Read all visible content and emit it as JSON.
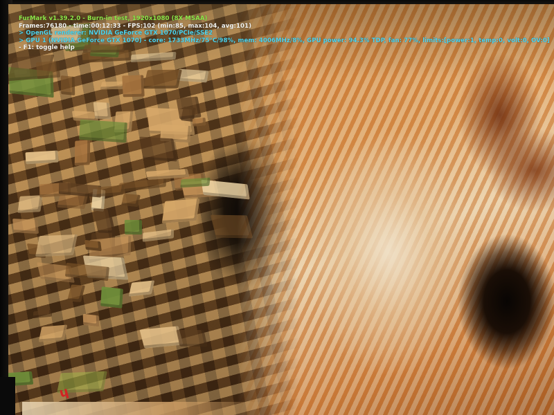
{
  "app": "FurMark",
  "osd": {
    "title": "FurMark v1.39.2.0 - Burn-in test, 1920x1080 (8X MSAA)",
    "frames": "Frames:76180 - time:00:12:33 - FPS:102 (min:85, max:104, avg:101)",
    "renderer": "> OpenGL renderer: NVIDIA GeForce GTX 1070/PCIe/SSE2",
    "gpu": "> GPU 1 (NVIDIA GeForce GTX 1070) - core: 1733MHz/75°C/98%, mem: 4006MHz/8%, GPU power: 94.3% TDP, fan: 77%, limits:[power:1, temp:0, volt:0, OV:0]",
    "help": "- F1: toggle help"
  },
  "colors": {
    "title": "#8fe84a",
    "info": "#f4f4f0",
    "accent": "#4fd6f0",
    "tunnel_tint": "#9a6a38",
    "fur_orange": "#c97a36",
    "fur_cream": "#eedcbc",
    "eye_dark": "#0a0604"
  },
  "scene": {
    "left": "cube-tunnel",
    "right": "fur-donut-closeup"
  }
}
